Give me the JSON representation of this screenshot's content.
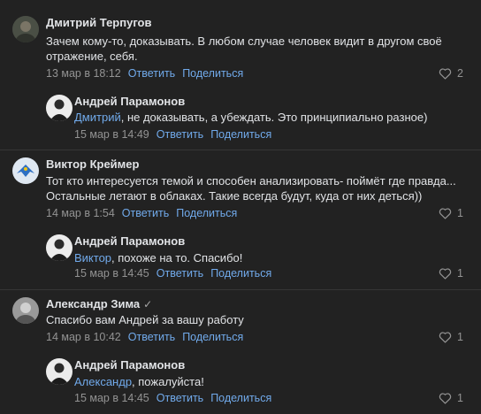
{
  "comments": [
    {
      "author": "Дмитрий Терпугов",
      "text1": "Зачем кому-то, доказывать. В любом случае человек видит в другом своё",
      "text2": "отражение, себя.",
      "time": "13 мар в 18:12",
      "reply": "Ответить",
      "share": "Поделиться",
      "likes": "2"
    },
    {
      "author": "Андрей Парамонов",
      "mention": "Дмитрий",
      "text": ", не доказывать, а убеждать. Это принципиально разное)",
      "time": "15 мар в 14:49",
      "reply": "Ответить",
      "share": "Поделиться"
    },
    {
      "author": "Виктор Креймер",
      "text1": "Тот кто интересуется темой и способен анализировать- поймёт где правда...",
      "text2": "Остальные летают в облаках. Такие всегда будут, куда от них деться))",
      "time": "14 мар в 1:54",
      "reply": "Ответить",
      "share": "Поделиться",
      "likes": "1"
    },
    {
      "author": "Андрей Парамонов",
      "mention": "Виктор",
      "text": ", похоже на то. Спасибо!",
      "time": "15 мар в 14:45",
      "reply": "Ответить",
      "share": "Поделиться",
      "likes": "1"
    },
    {
      "author": "Александр Зима",
      "verified_glyph": "✓",
      "text": "Спасибо вам Андрей за вашу работу",
      "time": "14 мар в 10:42",
      "reply": "Ответить",
      "share": "Поделиться",
      "likes": "1"
    },
    {
      "author": "Андрей Парамонов",
      "mention": "Александр",
      "text": ", пожалуйста!",
      "time": "15 мар в 14:45",
      "reply": "Ответить",
      "share": "Поделиться",
      "likes": "1"
    }
  ]
}
